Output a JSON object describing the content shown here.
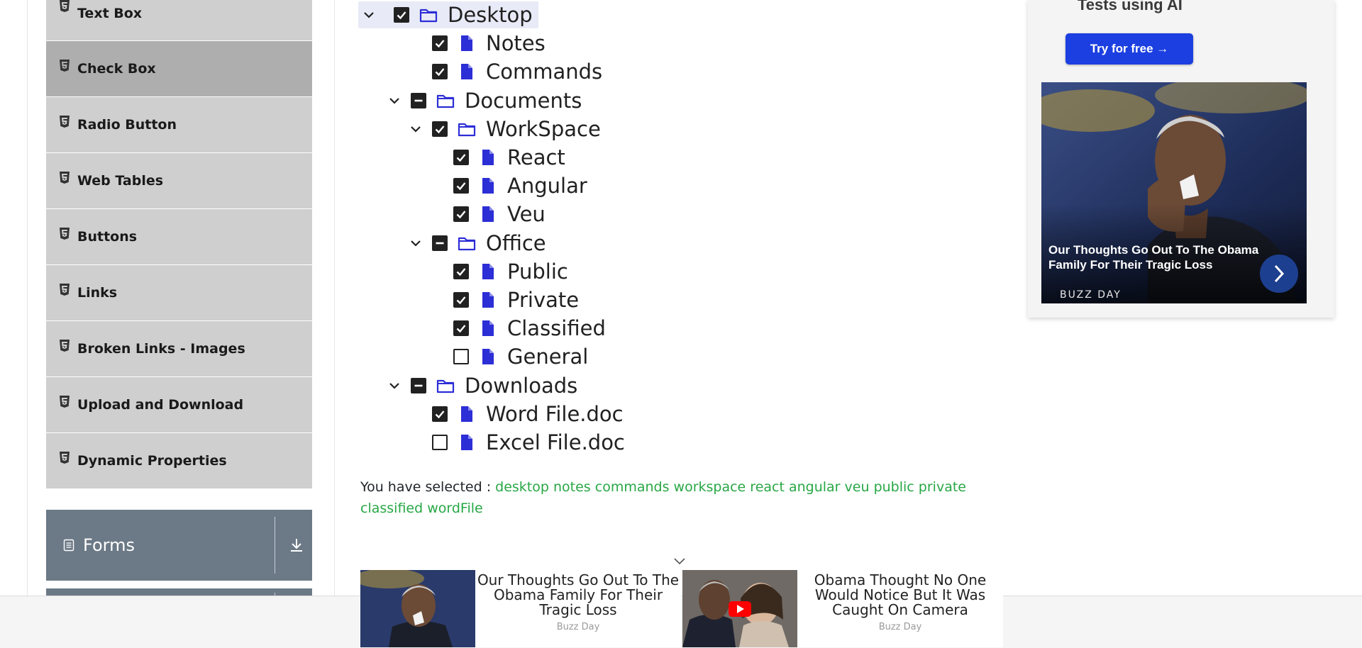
{
  "sidebar": {
    "items": [
      {
        "label": "Text Box"
      },
      {
        "label": "Check Box"
      },
      {
        "label": "Radio Button"
      },
      {
        "label": "Web Tables"
      },
      {
        "label": "Buttons"
      },
      {
        "label": "Links"
      },
      {
        "label": "Broken Links - Images"
      },
      {
        "label": "Upload and Download"
      },
      {
        "label": "Dynamic Properties"
      }
    ],
    "active_item": "Check Box",
    "group": {
      "title": "Forms"
    }
  },
  "tree": {
    "nodes": [
      {
        "label": "Desktop",
        "type": "folder",
        "state": "checked",
        "expanded": true
      },
      {
        "label": "Notes",
        "type": "file",
        "state": "checked"
      },
      {
        "label": "Commands",
        "type": "file",
        "state": "checked"
      },
      {
        "label": "Documents",
        "type": "folder",
        "state": "partial",
        "expanded": true
      },
      {
        "label": "WorkSpace",
        "type": "folder",
        "state": "checked",
        "expanded": true
      },
      {
        "label": "React",
        "type": "file",
        "state": "checked"
      },
      {
        "label": "Angular",
        "type": "file",
        "state": "checked"
      },
      {
        "label": "Veu",
        "type": "file",
        "state": "checked"
      },
      {
        "label": "Office",
        "type": "folder",
        "state": "partial",
        "expanded": true
      },
      {
        "label": "Public",
        "type": "file",
        "state": "checked"
      },
      {
        "label": "Private",
        "type": "file",
        "state": "checked"
      },
      {
        "label": "Classified",
        "type": "file",
        "state": "checked"
      },
      {
        "label": "General",
        "type": "file",
        "state": "unchecked"
      },
      {
        "label": "Downloads",
        "type": "folder",
        "state": "partial",
        "expanded": true
      },
      {
        "label": "Word File.doc",
        "type": "file",
        "state": "checked"
      },
      {
        "label": "Excel File.doc",
        "type": "file",
        "state": "unchecked"
      }
    ]
  },
  "result": {
    "prefix": "You have selected :",
    "selected": [
      "desktop",
      "notes",
      "commands",
      "workspace",
      "react",
      "angular",
      "veu",
      "public",
      "private",
      "classified",
      "wordFile"
    ]
  },
  "ad_right": {
    "top_text": "Tests using AI",
    "button_label": "Try for free →",
    "headline": "Our Thoughts Go Out To The Obama Family For Their Tragic Loss",
    "source": "BUZZ DAY"
  },
  "bottom_ads": [
    {
      "title": "Our Thoughts Go Out To The Obama Family For Their Tragic Loss",
      "source": "Buzz Day"
    },
    {
      "title": "Obama Thought No One Would Notice But It Was Caught On Camera",
      "source": "Buzz Day"
    }
  ],
  "colors": {
    "accent_blue": "#2c2ed6",
    "selected_green": "#28a745",
    "sidebar_item_bg": "#cfcfcf",
    "sidebar_active_bg": "#aeaeae",
    "group_header_bg": "#6c7986"
  }
}
